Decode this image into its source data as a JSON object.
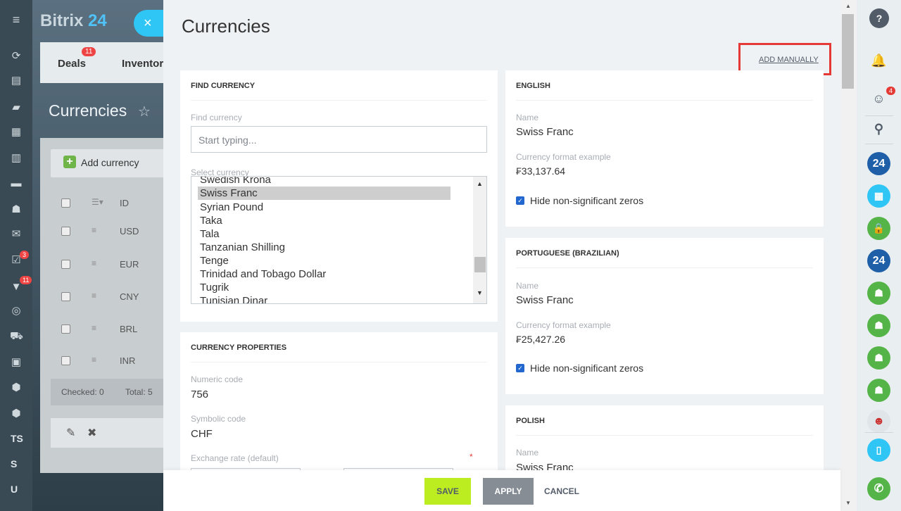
{
  "app": {
    "logo_a": "Bitrix",
    "logo_b": "24",
    "close": "×"
  },
  "left_nav": {
    "badges": [
      "3",
      "11"
    ],
    "letters": [
      "TS",
      "S",
      "U"
    ]
  },
  "background": {
    "tabs": [
      "Deals",
      "Inventor"
    ],
    "deals_badge": "11",
    "title": "Currencies",
    "add_currency": "Add currency",
    "col_id": "ID",
    "rows": [
      "USD",
      "EUR",
      "CNY",
      "BRL",
      "INR"
    ],
    "checked": "Checked: 0",
    "total": "Total: 5"
  },
  "slider": {
    "title": "Currencies",
    "add_manually": "ADD MANUALLY",
    "find": {
      "header": "FIND CURRENCY",
      "find_label": "Find currency",
      "find_placeholder": "Start typing...",
      "select_label": "Select currency",
      "options": [
        "Swedish Krona",
        "Swiss Franc",
        "Syrian Pound",
        "Taka",
        "Tala",
        "Tanzanian Shilling",
        "Tenge",
        "Trinidad and Tobago Dollar",
        "Tugrik",
        "Tunisian Dinar"
      ],
      "selected": "Swiss Franc"
    },
    "props": {
      "header": "CURRENCY PROPERTIES",
      "numeric_label": "Numeric code",
      "numeric_value": "756",
      "symbolic_label": "Symbolic code",
      "symbolic_value": "CHF",
      "rate_label": "Exchange rate (default)",
      "required": "*"
    },
    "langs": [
      {
        "header": "ENGLISH",
        "name_label": "Name",
        "name": "Swiss Franc",
        "format_label": "Currency format example",
        "format": "₣33,137.64",
        "zeros": "Hide non-significant zeros"
      },
      {
        "header": "PORTUGUESE (BRAZILIAN)",
        "name_label": "Name",
        "name": "Swiss Franc",
        "format_label": "Currency format example",
        "format": "₣25,427.26",
        "zeros": "Hide non-significant zeros"
      },
      {
        "header": "POLISH",
        "name_label": "Name",
        "name": "Swiss Franc"
      }
    ]
  },
  "buttons": {
    "save": "SAVE",
    "apply": "APPLY",
    "cancel": "CANCEL"
  },
  "right_bar": {
    "help": "?",
    "chat_badge": "4",
    "b24": "24",
    "colors": {
      "blue": "#1f5fa8",
      "green": "#55b448",
      "teal": "#2fc6f6",
      "phone": "#55b448"
    }
  }
}
